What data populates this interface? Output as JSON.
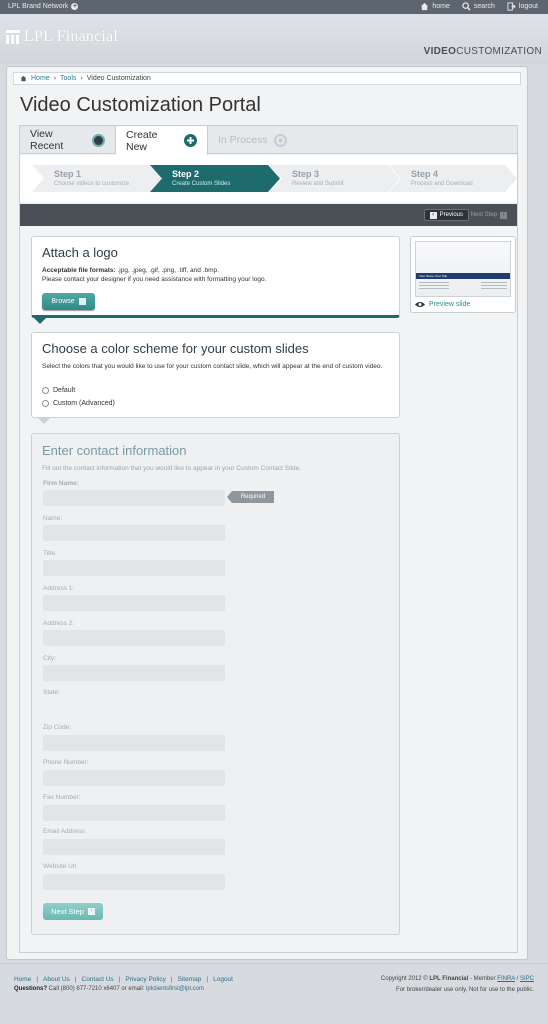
{
  "topbar": {
    "brand_network": "LPL Brand Network",
    "links": {
      "home": "home",
      "search": "search",
      "logout": "logout"
    }
  },
  "header": {
    "logo_text": "LPL Financial",
    "section_bold": "VIDEO",
    "section_rest": "CUSTOMIZATION"
  },
  "breadcrumb": {
    "home": "Home",
    "tools": "Tools",
    "current": "Video Customization"
  },
  "page_title": "Video Customization Portal",
  "tabs": {
    "view_recent": "View Recent",
    "create_new": "Create New",
    "in_process": "In Process"
  },
  "steps": [
    {
      "title": "Step 1",
      "sub": "Choose videos to customize"
    },
    {
      "title": "Step 2",
      "sub": "Create Custom Slides"
    },
    {
      "title": "Step 3",
      "sub": "Review and Submit"
    },
    {
      "title": "Step 4",
      "sub": "Process and Download"
    }
  ],
  "nav_buttons": {
    "previous": "Previous",
    "next": "Next Step"
  },
  "attach_logo": {
    "title": "Attach a logo",
    "formats_label": "Acceptable file formats:",
    "formats": " .jpg, .jpeg, .gif, .png, .tiff, and .bmp.",
    "help": "Please contact your designer if you need assistance with formatting your logo.",
    "browse": "Browse"
  },
  "color_scheme": {
    "title": "Choose a color scheme for your custom slides",
    "desc": "Select the colors that you would like to use for your custom contact slide, which will appear at the end of custom video.",
    "options": [
      "Default",
      "Custom (Advanced)"
    ]
  },
  "contact": {
    "title": "Enter contact information",
    "desc": "Fill out the contact information that you would like to appear in your Custom Contact Slide.",
    "required": "Required",
    "fields": [
      "Firm Name:",
      "Name:",
      "Title:",
      "Address 1:",
      "Address 2:",
      "City:",
      "State:",
      "Zip Code:",
      "Phone Number:",
      "Fax Number:",
      "Email Address:",
      "Website Url"
    ],
    "next_step": "Next Step"
  },
  "preview": {
    "link": "Preview slide",
    "band_name": "Your Name",
    "band_title": "Your Title"
  },
  "footer": {
    "links": [
      "Home",
      "About Us",
      "Contact Us",
      "Privacy Policy",
      "Sitemap",
      "Logout"
    ],
    "questions_label": "Questions?",
    "questions_text": " Call (800) 877-7210 x6407 or email: ",
    "email": "lplclientsfirst@lpl.com",
    "copyright_pre": "Copyright 2012 © ",
    "copyright_brand": "LPL Financial",
    "copyright_mid": " - Member ",
    "finra": "FINRA",
    "slash": " / ",
    "sipc": "SIPC",
    "disclaimer": "For broker/dealer use only. Not for use to the public."
  },
  "colors": {
    "accent": "#1e6b6e",
    "topbar": "#5d6670",
    "darkbar": "#4a5056",
    "link": "#2a7d8a"
  }
}
